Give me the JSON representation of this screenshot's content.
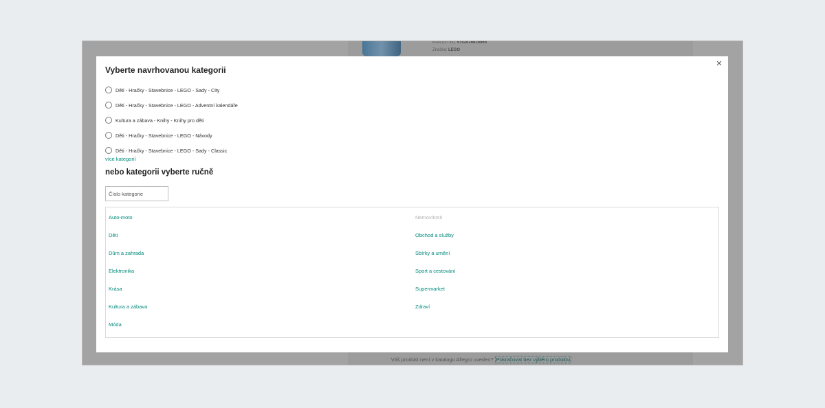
{
  "background": {
    "meta": [
      {
        "label": "EAN (GTIN):",
        "value": "5702016616965"
      },
      {
        "label": "Značka:",
        "value": "LEGO"
      }
    ],
    "footer_text": "Váš produkt není v katalogu Allegro uveden?",
    "footer_link": "Pokračovat bez výběru produktu"
  },
  "modal": {
    "close_label": "×",
    "title": "Vyberte navrhovanou kategorii",
    "suggested": [
      "Děti - Hračky - Stavebnice - LEGO - Sady - City",
      "Děti - Hračky - Stavebnice - LEGO - Adventní kalendáře",
      "Kultura a zábava - Knihy - Knihy pro děti",
      "Děti - Hračky - Stavebnice - LEGO - Návody",
      "Děti - Hračky - Stavebnice - LEGO - Sady - Classic"
    ],
    "more_link": "více kategorií",
    "subtitle": "nebo kategorii vyberte ručně",
    "input_placeholder": "Číslo kategorie",
    "categories_left": [
      "Auto-moto",
      "Děti",
      "Dům a zahrada",
      "Elektronika",
      "Krása",
      "Kultura a zábava",
      "Móda"
    ],
    "categories_right": [
      "Nemovitosti",
      "Obchod a služby",
      "Sbírky a umění",
      "Sport a cestování",
      "Supermarket",
      "Zdraví"
    ],
    "disabled_categories": [
      "Nemovitosti"
    ]
  },
  "colors": {
    "accent": "#00897b",
    "overlay": "#a3a3a3",
    "page_bg": "#e9edf0"
  }
}
